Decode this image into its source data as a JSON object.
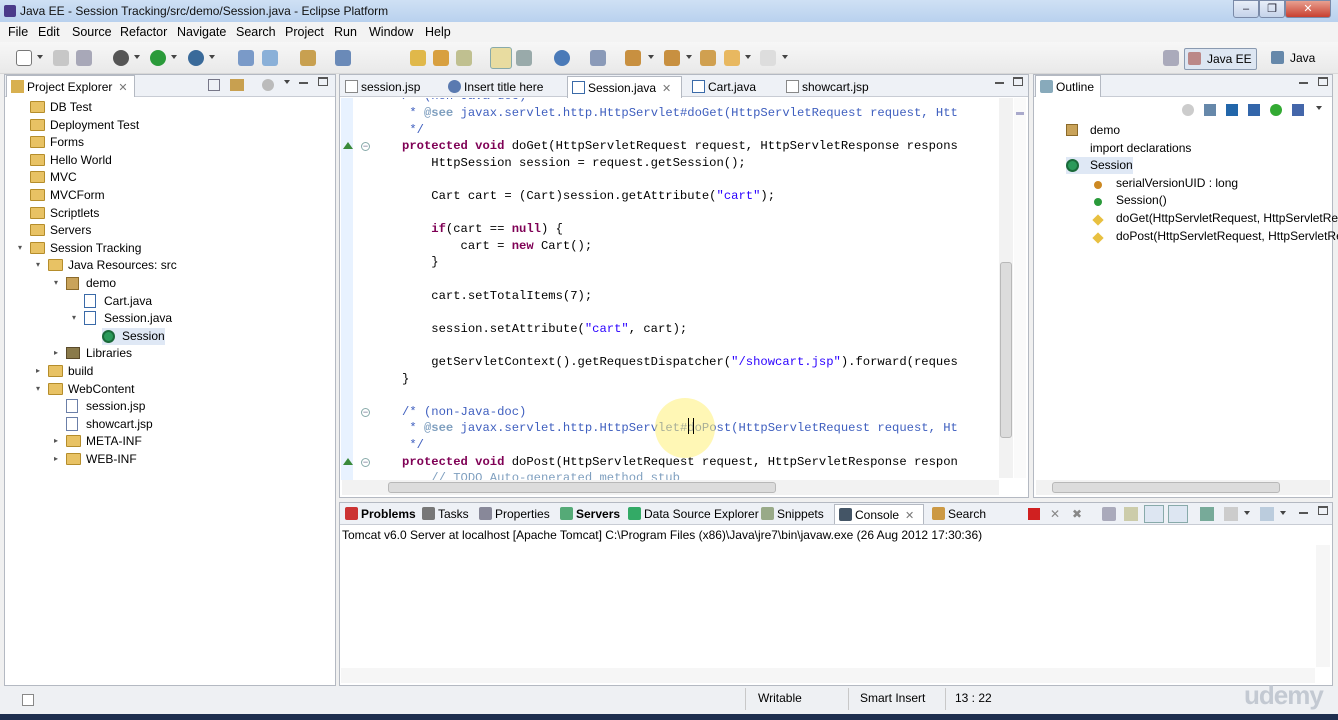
{
  "window": {
    "title": "Java EE - Session Tracking/src/demo/Session.java - Eclipse Platform"
  },
  "menu": [
    "File",
    "Edit",
    "Source",
    "Refactor",
    "Navigate",
    "Search",
    "Project",
    "Run",
    "Window",
    "Help"
  ],
  "perspectives": {
    "active": "Java EE",
    "other": "Java"
  },
  "project_explorer": {
    "tab": "Project Explorer",
    "items": [
      {
        "label": "DB Test",
        "kind": "project"
      },
      {
        "label": "Deployment Test",
        "kind": "project"
      },
      {
        "label": "Forms",
        "kind": "project"
      },
      {
        "label": "Hello World",
        "kind": "project"
      },
      {
        "label": "MVC",
        "kind": "project"
      },
      {
        "label": "MVCForm",
        "kind": "project"
      },
      {
        "label": "Scriptlets",
        "kind": "project"
      },
      {
        "label": "Servers",
        "kind": "project"
      },
      {
        "label": "Session Tracking",
        "kind": "project"
      },
      {
        "label": "Java Resources: src",
        "kind": "src"
      },
      {
        "label": "demo",
        "kind": "package"
      },
      {
        "label": "Cart.java",
        "kind": "java"
      },
      {
        "label": "Session.java",
        "kind": "java"
      },
      {
        "label": "Session",
        "kind": "class"
      },
      {
        "label": "Libraries",
        "kind": "lib"
      },
      {
        "label": "build",
        "kind": "folder"
      },
      {
        "label": "WebContent",
        "kind": "folder"
      },
      {
        "label": "session.jsp",
        "kind": "jsp"
      },
      {
        "label": "showcart.jsp",
        "kind": "jsp"
      },
      {
        "label": "META-INF",
        "kind": "folder"
      },
      {
        "label": "WEB-INF",
        "kind": "folder"
      }
    ]
  },
  "editor": {
    "tabs": [
      "session.jsp",
      "Insert title here",
      "Session.java",
      "Cart.java",
      "showcart.jsp"
    ],
    "active_tab": "Session.java",
    "lines": [
      {
        "t": " * @see javax.servlet.http.HttpServlet#doGet(HttpServletRequest request, Htt",
        "c": "doc"
      },
      {
        "t": " */",
        "c": "doc"
      },
      {
        "t": "protected void doGet(HttpServletRequest request, HttpServletResponse respons",
        "c": "code"
      },
      {
        "t": "    HttpSession session = request.getSession();",
        "c": "code"
      },
      {
        "t": "",
        "c": "code"
      },
      {
        "t": "    Cart cart = (Cart)session.getAttribute(\"cart\");",
        "c": "code"
      },
      {
        "t": "",
        "c": "code"
      },
      {
        "t": "    if(cart == null) {",
        "c": "code"
      },
      {
        "t": "        cart = new Cart();",
        "c": "code"
      },
      {
        "t": "    }",
        "c": "code"
      },
      {
        "t": "",
        "c": "code"
      },
      {
        "t": "    cart.setTotalItems(7);",
        "c": "code"
      },
      {
        "t": "",
        "c": "code"
      },
      {
        "t": "    session.setAttribute(\"cart\", cart);",
        "c": "code"
      },
      {
        "t": "",
        "c": "code"
      },
      {
        "t": "    getServletContext().getRequestDispatcher(\"/showcart.jsp\").forward(reques",
        "c": "code"
      },
      {
        "t": "}",
        "c": "code"
      },
      {
        "t": "",
        "c": "code"
      },
      {
        "t": "/* (non-Java-doc)",
        "c": "cmt"
      },
      {
        "t": " * @see javax.servlet.http.HttpServlet#doPost(HttpServletRequest request, Ht",
        "c": "doc"
      },
      {
        "t": " */",
        "c": "doc"
      },
      {
        "t": "protected void doPost(HttpServletRequest request, HttpServletResponse respon",
        "c": "code"
      }
    ]
  },
  "outline": {
    "tab": "Outline",
    "items": [
      {
        "label": "demo"
      },
      {
        "label": "import declarations"
      },
      {
        "label": "Session"
      },
      {
        "label": "serialVersionUID : long"
      },
      {
        "label": "Session()"
      },
      {
        "label": "doGet(HttpServletRequest, HttpServletRes"
      },
      {
        "label": "doPost(HttpServletRequest, HttpServletRe"
      }
    ]
  },
  "console": {
    "tabs": [
      "Problems",
      "Tasks",
      "Properties",
      "Servers",
      "Data Source Explorer",
      "Snippets",
      "Console",
      "Search"
    ],
    "active_tab": "Console",
    "header": "Tomcat v6.0 Server at localhost [Apache Tomcat] C:\\Program Files (x86)\\Java\\jre7\\bin\\javaw.exe (26 Aug 2012 17:30:36)"
  },
  "status": {
    "writable": "Writable",
    "insert_mode": "Smart Insert",
    "position": "13 : 22"
  },
  "watermark": "udemy"
}
